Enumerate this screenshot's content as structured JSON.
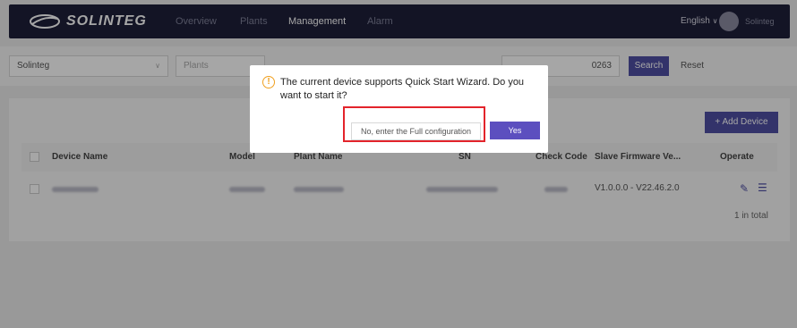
{
  "brand": {
    "name": "SOLINTEG"
  },
  "nav": {
    "items": [
      {
        "label": "Overview",
        "active": false
      },
      {
        "label": "Plants",
        "active": false
      },
      {
        "label": "Management",
        "active": true
      },
      {
        "label": "Alarm",
        "active": false
      }
    ],
    "language": "English",
    "user": "Solinteg"
  },
  "filters": {
    "company": "Solinteg",
    "plant_placeholder": "Plants",
    "sn_partial": "0263",
    "search_label": "Search",
    "reset_label": "Reset"
  },
  "table": {
    "add_button": "+ Add Device",
    "columns": [
      "Device Name",
      "Model",
      "Plant Name",
      "SN",
      "Check Code",
      "Slave Firmware Ve...",
      "Operate"
    ],
    "rows": [
      {
        "firmware": "V1.0.0.0 - V22.46.2.0"
      }
    ],
    "total_text": "1 in total"
  },
  "modal": {
    "message": "The current device supports Quick Start Wizard. Do you want to start it?",
    "no_label": "No, enter the Full configuration",
    "yes_label": "Yes"
  },
  "colors": {
    "nav_bg": "#1e1f3a",
    "primary": "#4f4fa3",
    "highlight_border": "#e3242b",
    "warning": "#f0a020"
  }
}
